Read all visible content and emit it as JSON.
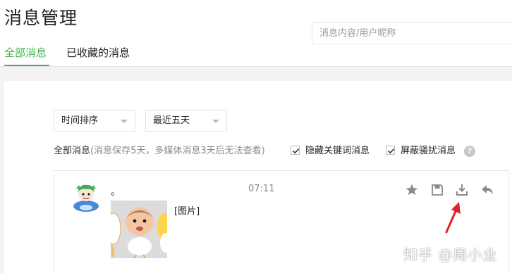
{
  "header": {
    "title": "消息管理",
    "search_placeholder": "消息内容/用户昵称",
    "tabs": [
      {
        "label": "全部消息",
        "active": true
      },
      {
        "label": "已收藏的消息",
        "active": false
      }
    ]
  },
  "filters": {
    "sort_select": "时间排序",
    "range_select": "最近五天",
    "summary_prefix": "全部消息",
    "summary_note": "(消息保存5天，多媒体消息3天后无法查看)",
    "checkboxes": [
      {
        "label": "隐藏关键词消息",
        "checked": true
      },
      {
        "label": "屏蔽骚扰消息",
        "checked": true
      }
    ],
    "help_icon": "?"
  },
  "message": {
    "sender_name": "。",
    "time": "07:11",
    "content_label": "[图片]",
    "actions": [
      "star-icon",
      "save-icon",
      "download-icon",
      "reply-icon"
    ]
  },
  "watermark": "知乎 @周小业",
  "colors": {
    "accent": "#44b549",
    "annotation_arrow": "#e0202a"
  }
}
